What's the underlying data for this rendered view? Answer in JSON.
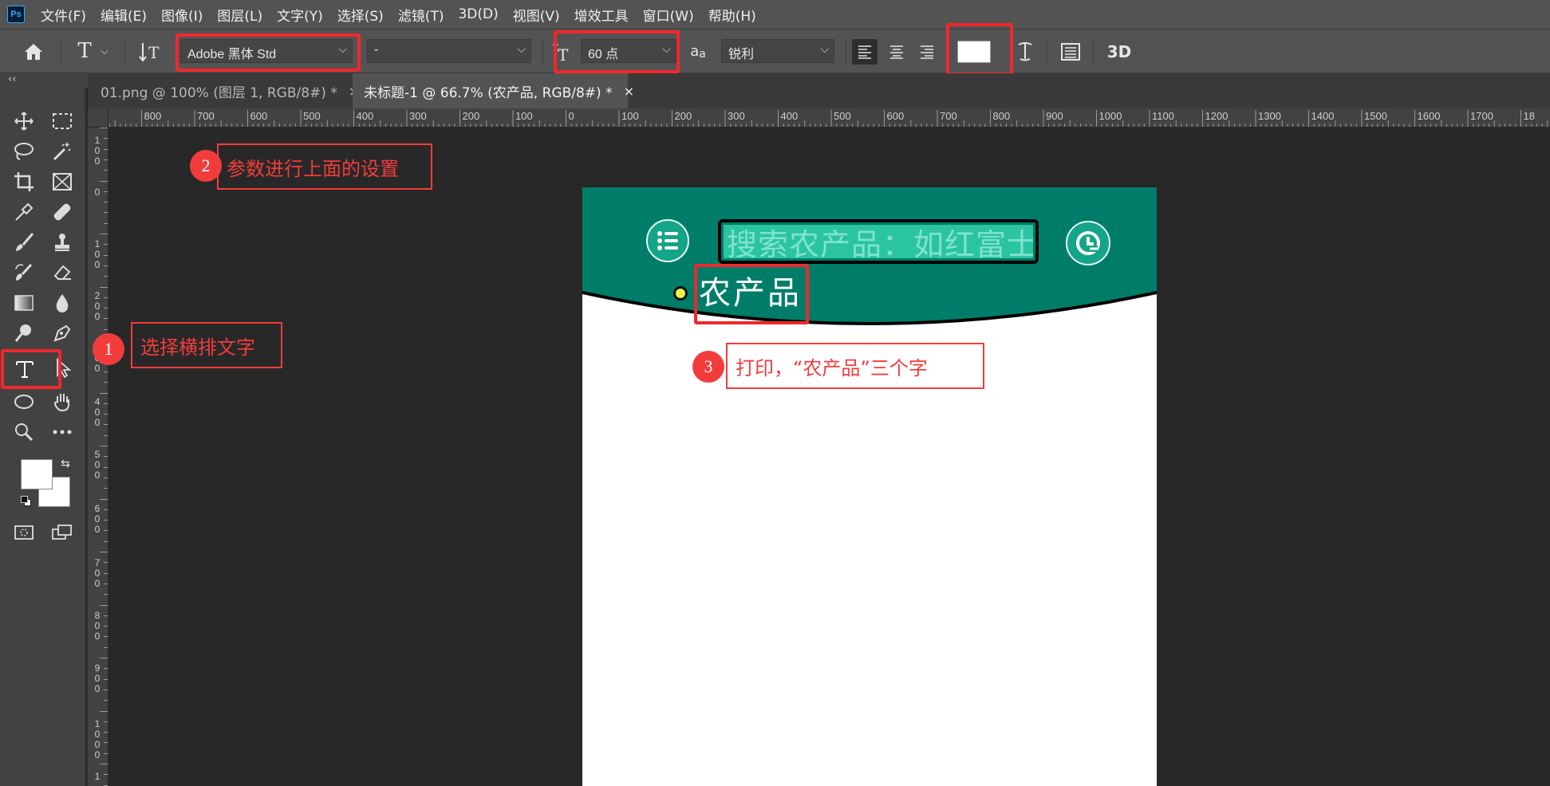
{
  "app": {
    "logo": "Ps"
  },
  "menu": [
    "文件(F)",
    "编辑(E)",
    "图像(I)",
    "图层(L)",
    "文字(Y)",
    "选择(S)",
    "滤镜(T)",
    "3D(D)",
    "视图(V)",
    "增效工具",
    "窗口(W)",
    "帮助(H)"
  ],
  "options": {
    "font_family": "Adobe 黑体 Std",
    "font_style": "-",
    "font_size": "60 点",
    "antialias_icon_text": "a",
    "antialias_icon_sub": "a",
    "antialias": "锐利",
    "label_3d": "3D",
    "text_color": "#ffffff"
  },
  "panel": {
    "collapse": "‹‹"
  },
  "tabs": [
    {
      "label": "01.png @ 100% (图层 1, RGB/8#) *",
      "close": "×",
      "active": false
    },
    {
      "label": "未标题-1 @ 66.7% (农产品, RGB/8#) *",
      "close": "×",
      "active": true
    }
  ],
  "ruler_top": [
    "900",
    "800",
    "700",
    "600",
    "500",
    "400",
    "300",
    "200",
    "100",
    "0",
    "100",
    "200",
    "300",
    "400",
    "500",
    "600",
    "700",
    "800",
    "900",
    "1000",
    "1100",
    "1200",
    "1300",
    "1400",
    "1500",
    "1600",
    "1700",
    "18"
  ],
  "ruler_left": [
    "1\n0\n0",
    "0",
    "1\n0\n0",
    "2\n0\n0",
    "3\n0\n0",
    "4\n0\n0",
    "5\n0\n0",
    "6\n0\n0",
    "7\n0\n0",
    "8\n0\n0",
    "9\n0\n0",
    "1\n0\n0\n0",
    "1"
  ],
  "document": {
    "search_text": "搜索农产品：如红富士",
    "typed_text": "农产品",
    "header_color": "#007d68",
    "search_bg": "#2bc4a0",
    "search_text_color": "#7fe3cc"
  },
  "annotations": [
    {
      "number": "1",
      "text": "选择横排文字"
    },
    {
      "number": "2",
      "text": "参数进行上面的设置"
    },
    {
      "number": "3",
      "text": "打印，“农产品”三个字"
    }
  ]
}
